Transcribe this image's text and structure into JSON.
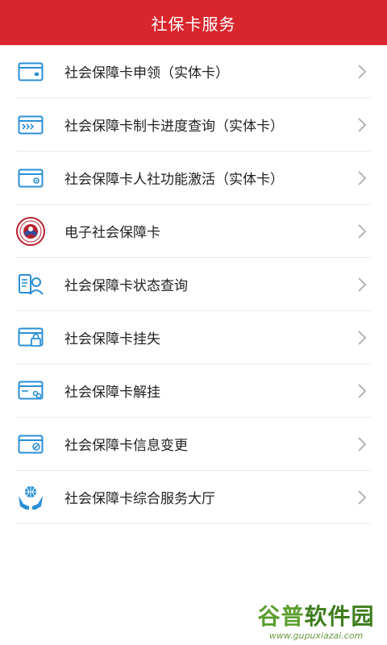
{
  "header": {
    "title": "社保卡服务"
  },
  "items": [
    {
      "label": "社会保障卡申领（实体卡）",
      "icon": "card-icon"
    },
    {
      "label": "社会保障卡制卡进度查询（实体卡）",
      "icon": "card-progress-icon"
    },
    {
      "label": "社会保障卡人社功能激活（实体卡）",
      "icon": "card-activate-icon"
    },
    {
      "label": "电子社会保障卡",
      "icon": "social-security-seal-icon"
    },
    {
      "label": "社会保障卡状态查询",
      "icon": "status-query-icon"
    },
    {
      "label": "社会保障卡挂失",
      "icon": "card-lock-icon"
    },
    {
      "label": "社会保障卡解挂",
      "icon": "card-unlock-icon"
    },
    {
      "label": "社会保障卡信息变更",
      "icon": "card-edit-icon"
    },
    {
      "label": "社会保障卡综合服务大厅",
      "icon": "service-hall-icon"
    }
  ],
  "watermark": {
    "logo_a": "谷普",
    "logo_b": "软件园",
    "url": "www.gupuxiazai.com"
  },
  "colors": {
    "header": "#d8262c",
    "icon": "#2a8fd6",
    "chevron": "#b5b5b5"
  }
}
